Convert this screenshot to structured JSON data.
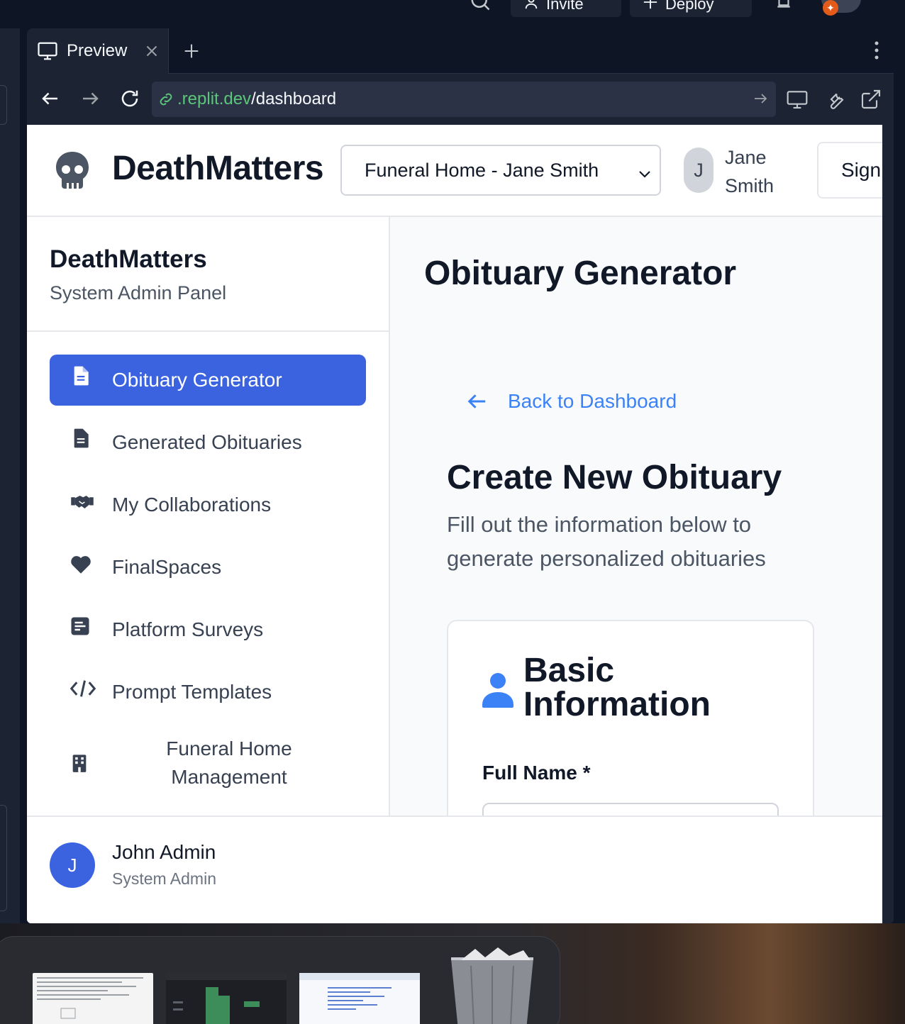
{
  "ide": {
    "invite_label": "Invite",
    "deploy_label": "Deploy"
  },
  "preview": {
    "tab_label": "Preview",
    "url_domain": ".replit.dev",
    "url_path": "/dashboard"
  },
  "app": {
    "brand": "DeathMatters",
    "home_select": "Funeral Home - Jane Smith",
    "user_initial": "J",
    "user_first": "Jane",
    "user_last": "Smith",
    "sign_label": "Sign",
    "sidebar": {
      "title": "DeathMatters",
      "subtitle": "System Admin Panel",
      "items": [
        {
          "label": "Obituary Generator",
          "icon": "document-icon",
          "active": true
        },
        {
          "label": "Generated Obituaries",
          "icon": "document-icon",
          "active": false
        },
        {
          "label": "My Collaborations",
          "icon": "handshake-icon",
          "active": false
        },
        {
          "label": "FinalSpaces",
          "icon": "heart-icon",
          "active": false
        },
        {
          "label": "Platform Surveys",
          "icon": "poll-icon",
          "active": false
        },
        {
          "label": "Prompt Templates",
          "icon": "code-icon",
          "active": false
        },
        {
          "label": "Funeral Home Management",
          "icon": "building-icon",
          "active": false
        }
      ]
    },
    "main": {
      "page_title": "Obituary Generator",
      "back_label": "Back to Dashboard",
      "create_title": "Create New Obituary",
      "create_subtitle": "Fill out the information below to generate personalized obituaries",
      "card_title": "Basic Information",
      "full_name_label": "Full Name *"
    },
    "footer_user": {
      "initial": "J",
      "name": "John Admin",
      "role": "System Admin"
    }
  },
  "colors": {
    "accent": "#3b63e0",
    "link": "#3b82f6",
    "url_domain": "#5bc67a"
  }
}
